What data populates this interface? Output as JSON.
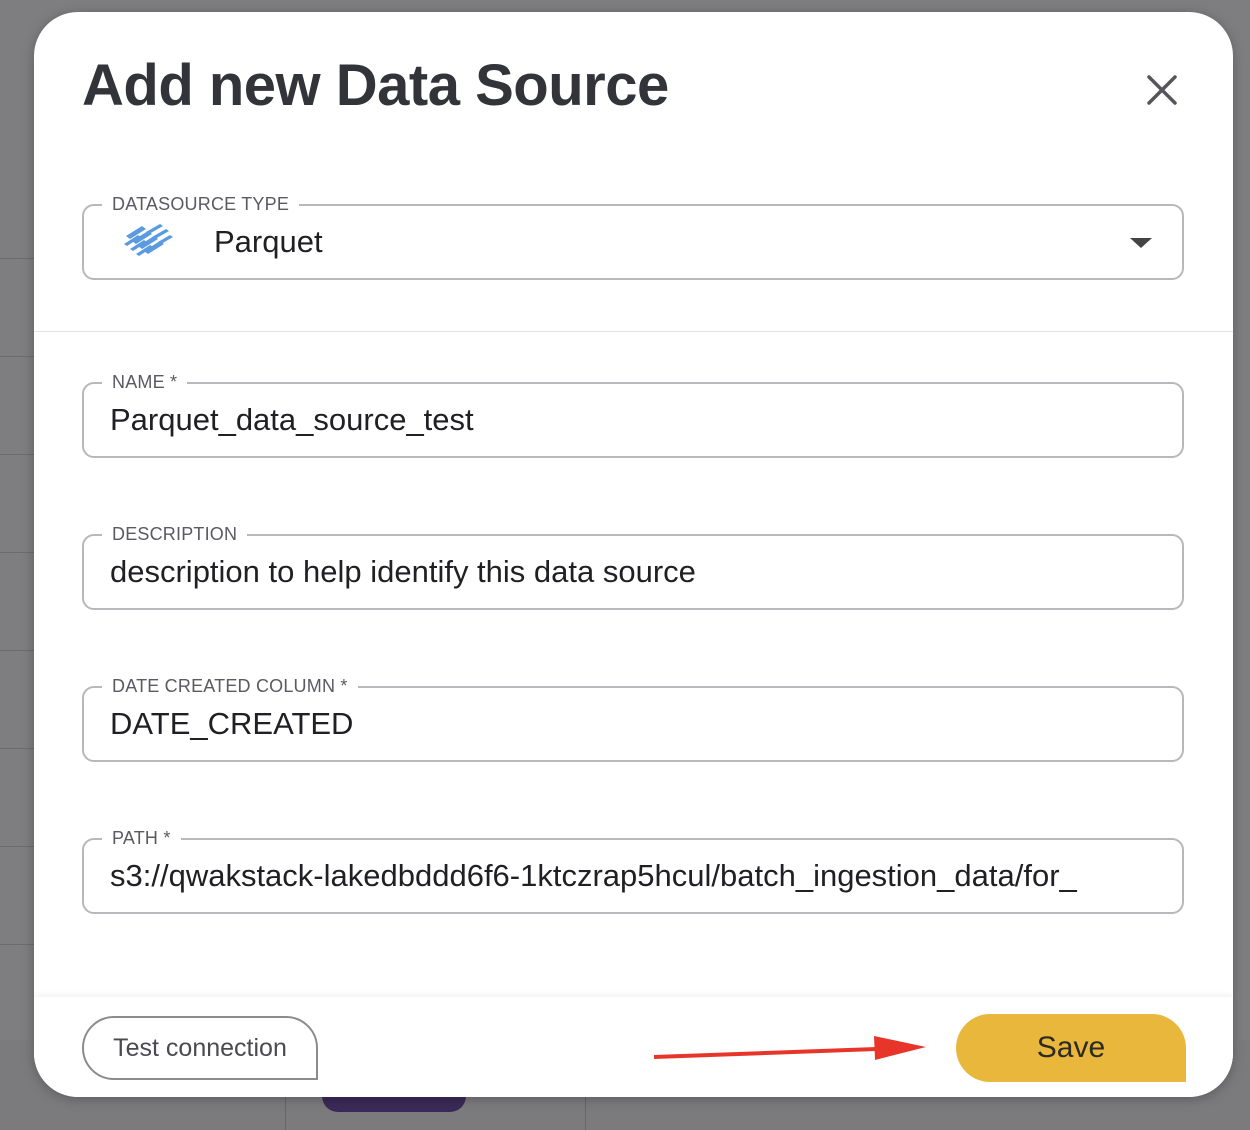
{
  "modal": {
    "title": "Add new Data Source"
  },
  "datasource_type": {
    "label": "DATASOURCE TYPE",
    "value": "Parquet",
    "icon": "parquet-logo-icon"
  },
  "name_field": {
    "label": "NAME *",
    "value": "Parquet_data_source_test"
  },
  "description_field": {
    "label": "DESCRIPTION",
    "value": "description to help identify this data source"
  },
  "date_created_field": {
    "label": "DATE CREATED COLUMN *",
    "value": "DATE_CREATED"
  },
  "path_field": {
    "label": "PATH *",
    "value": "s3://qwakstack-lakedbddd6f6-1ktczrap5hcul/batch_ingestion_data/for_"
  },
  "footer": {
    "test_label": "Test connection",
    "save_label": "Save"
  },
  "colors": {
    "accent": "#e9b73c",
    "annotation_arrow": "#e8352a"
  }
}
